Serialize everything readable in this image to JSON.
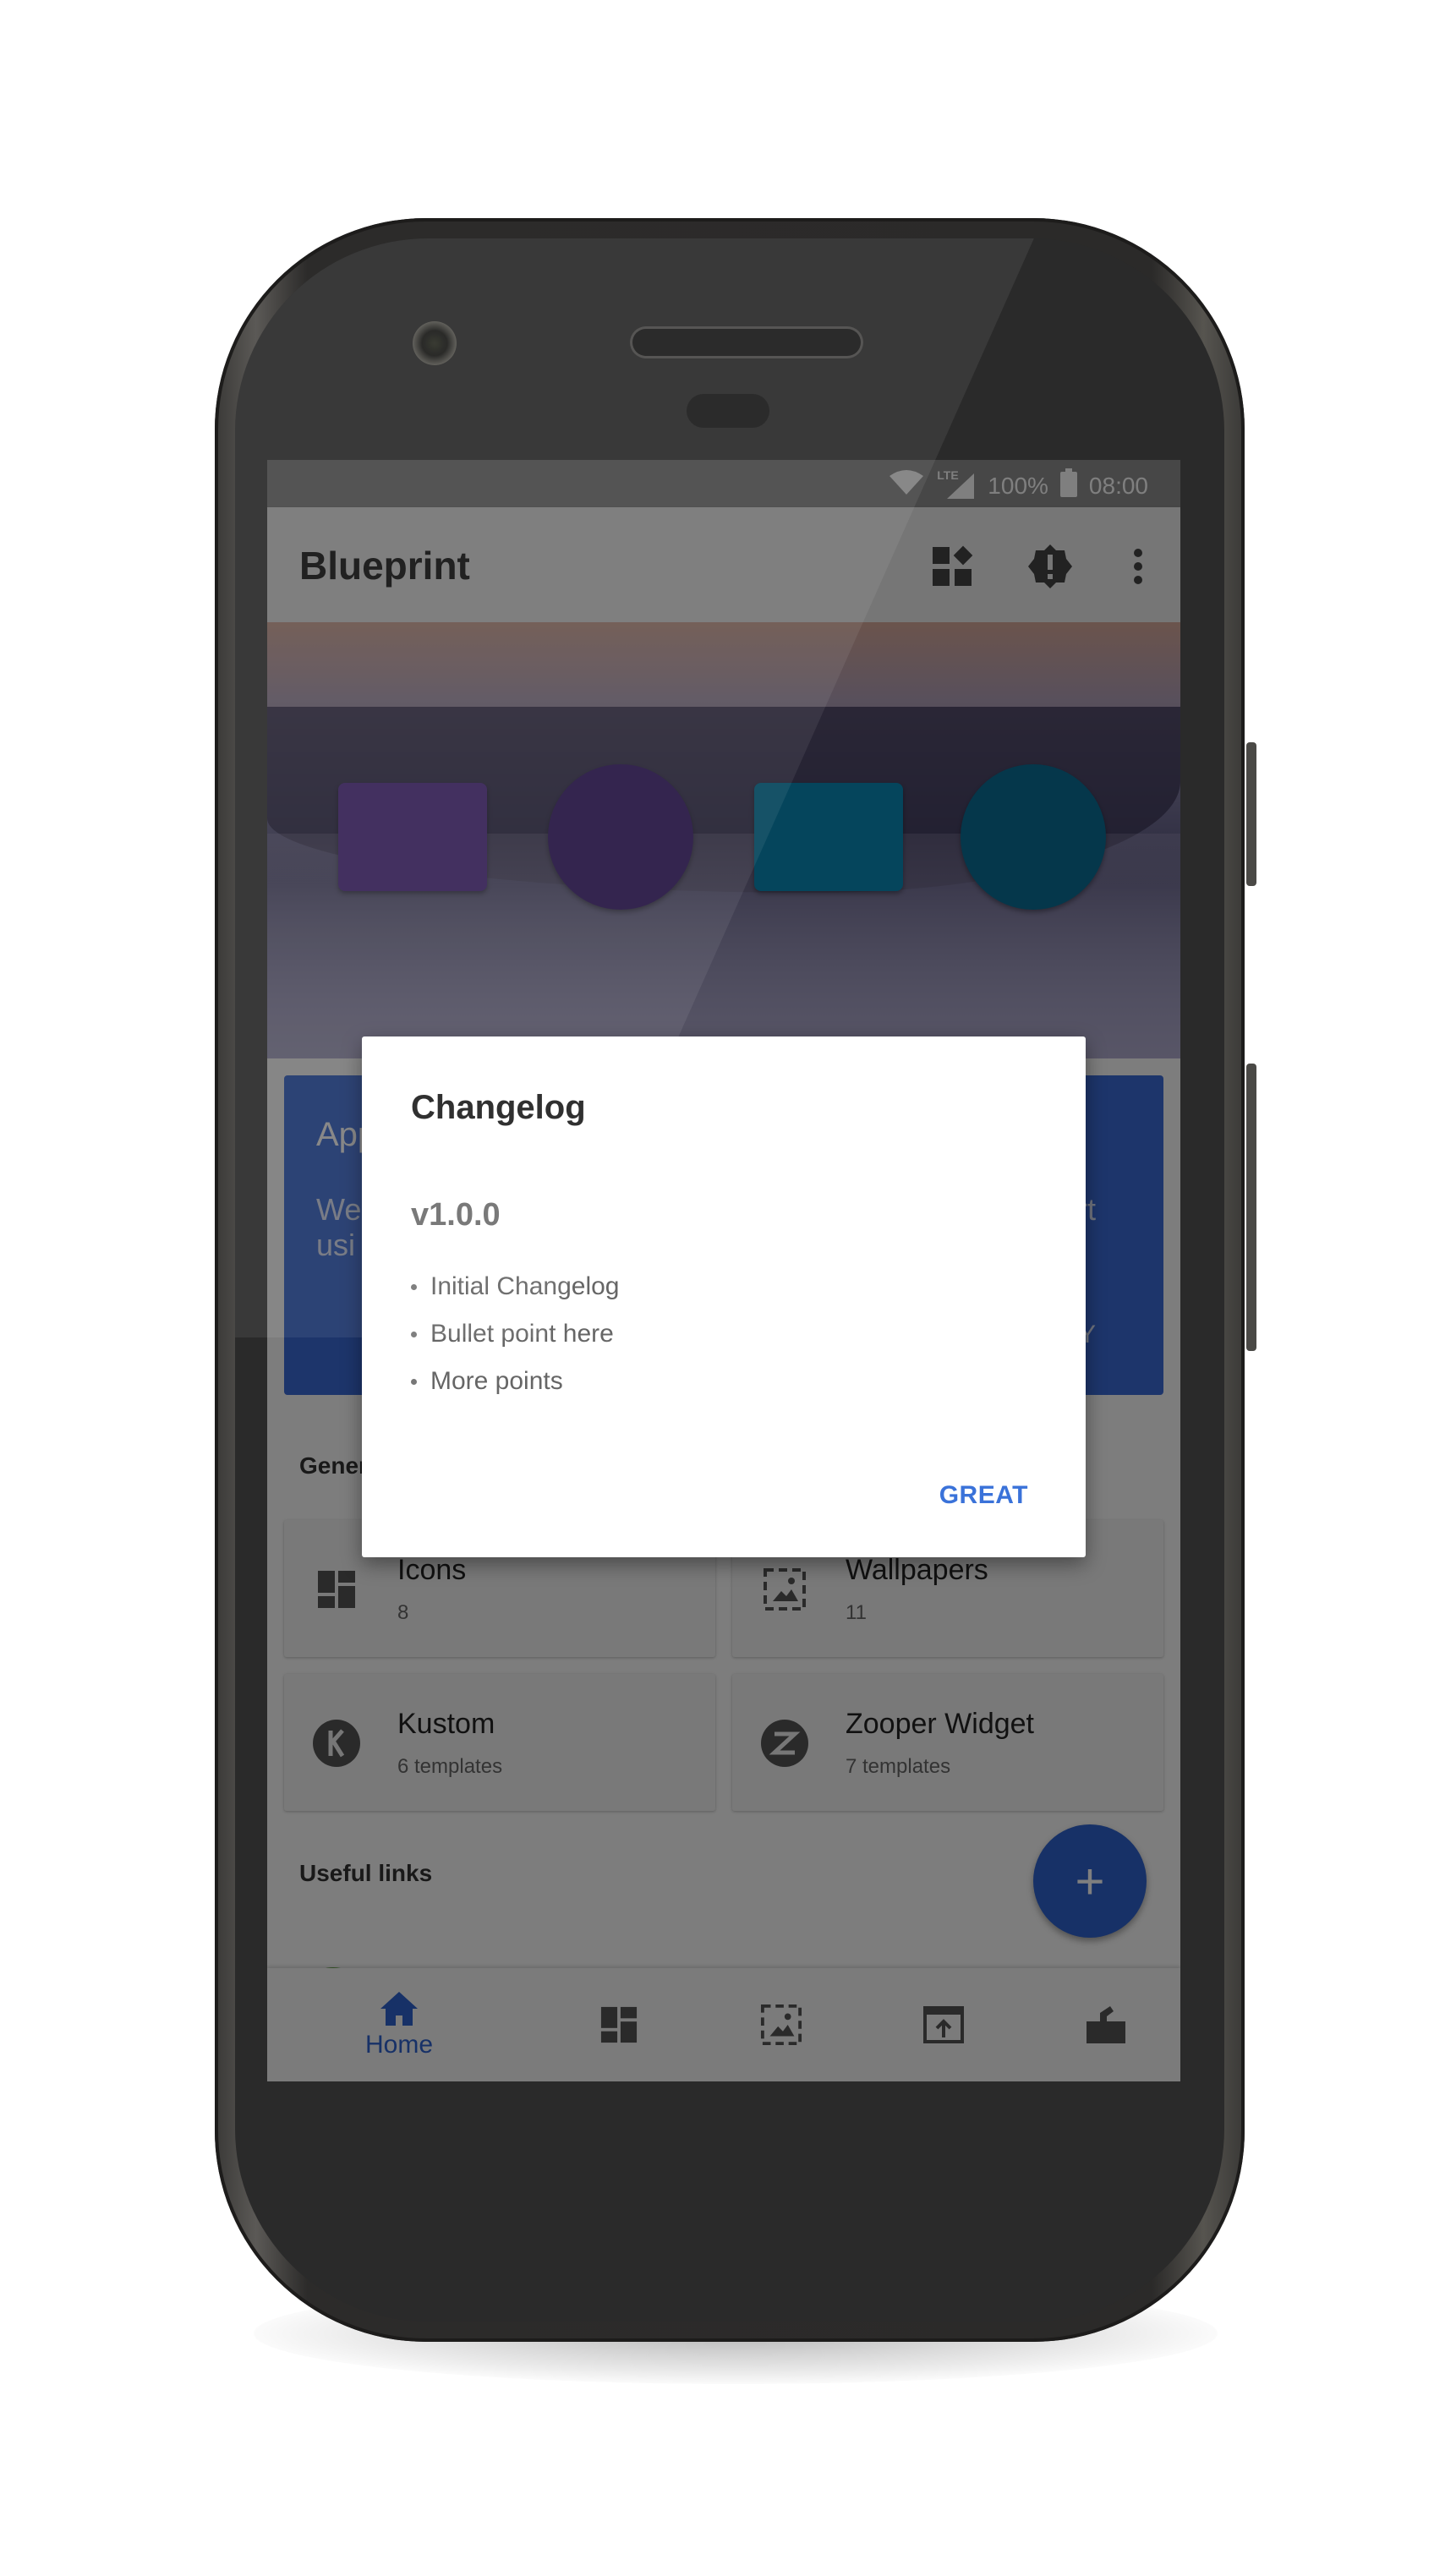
{
  "status_bar": {
    "battery_text": "100%",
    "time": "08:00",
    "network_label": "LTE"
  },
  "app_bar": {
    "title": "Blueprint"
  },
  "banner": {
    "title_partial": "App",
    "line1_partial": "We",
    "line2_partial": "usi",
    "line1_right_partial": "rt",
    "action_partial": "Y"
  },
  "section_general": "Gener",
  "cards": [
    {
      "name": "Icons",
      "sub": "8"
    },
    {
      "name": "Wallpapers",
      "sub": "11"
    },
    {
      "name": "Kustom",
      "sub": "6 templates"
    },
    {
      "name": "Zooper Widget",
      "sub": "7 templates"
    }
  ],
  "section_links": "Useful links",
  "fab_symbol": "+",
  "bottom_nav": {
    "home_label": "Home"
  },
  "dialog": {
    "title": "Changelog",
    "version": "v1.0.0",
    "items": [
      "Initial Changelog",
      "Bullet point here",
      "More points"
    ],
    "button": "GREAT"
  },
  "colors": {
    "accent": "#3a72d9",
    "fab": "#2f62cf",
    "banner": "#3b6ad6",
    "purple_shape": "#5b3b94",
    "teal_shape": "#0d7fa6"
  }
}
